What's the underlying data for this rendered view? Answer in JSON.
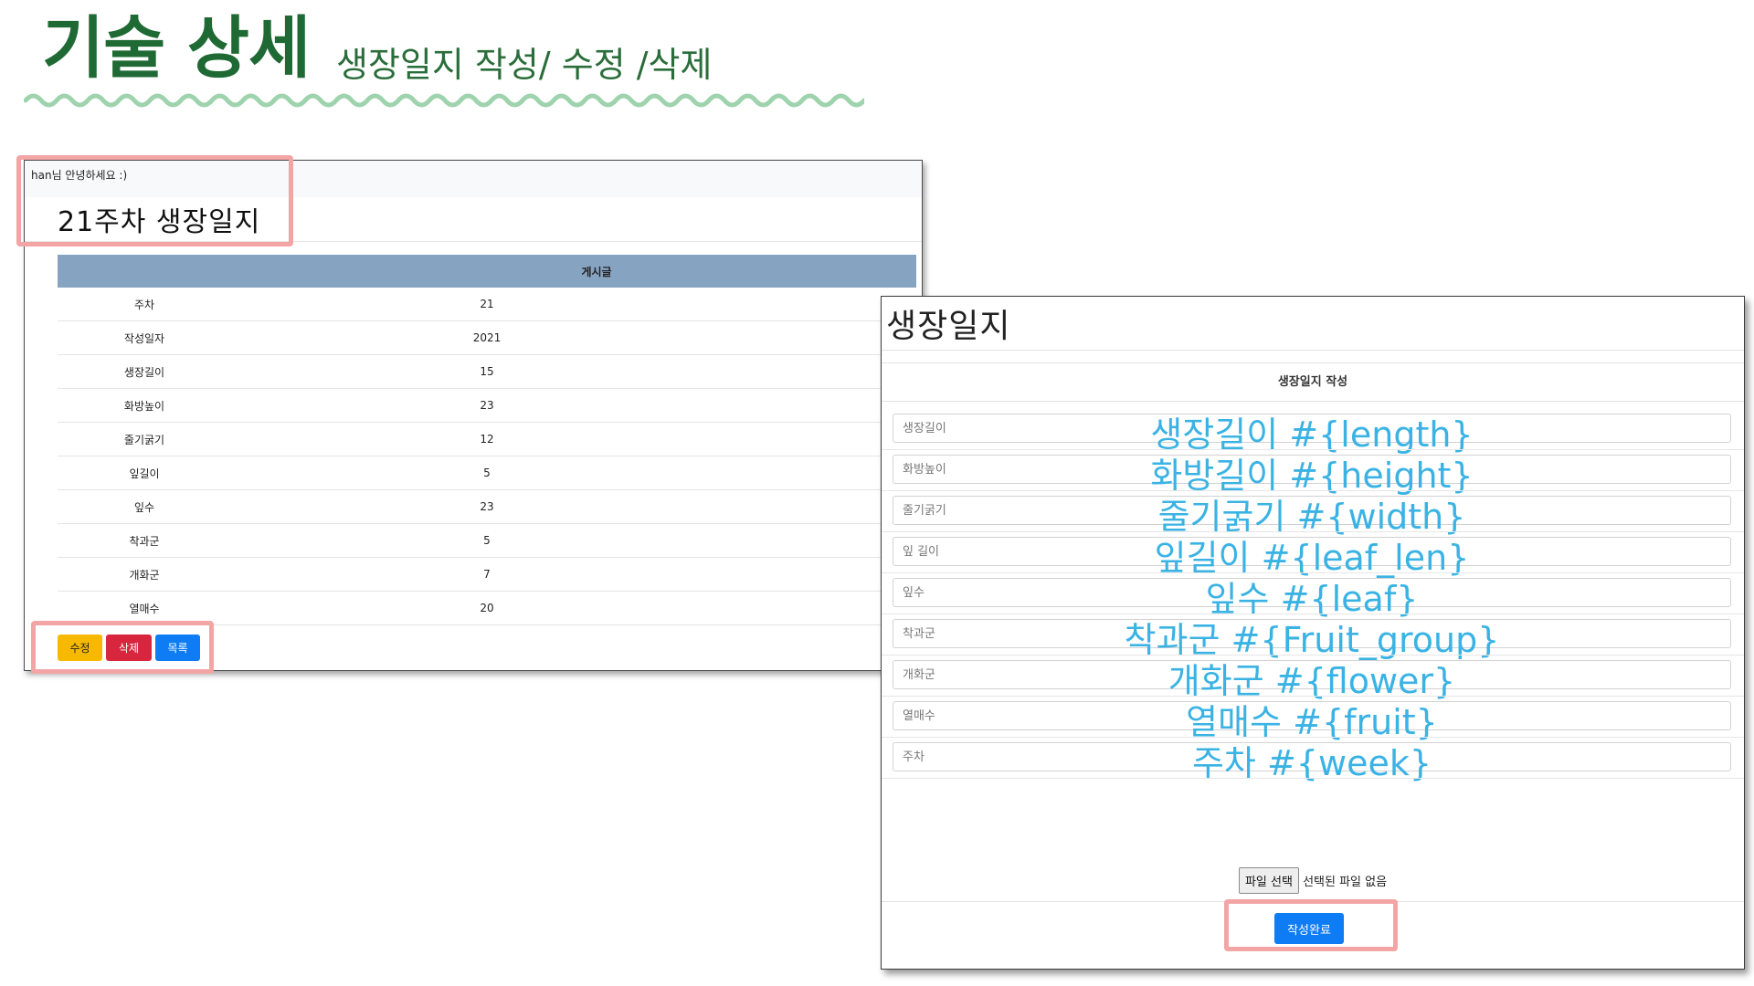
{
  "slide": {
    "title": "기술 상세",
    "subtitle": "생장일지 작성/ 수정 /삭제",
    "accent_color": "#1f6a34",
    "wave_color": "#9ed3ad"
  },
  "detail_view": {
    "greeting": "han님 안녕하세요 :)",
    "page_title": "21주차 생장일지",
    "table_header": "게시글",
    "rows": [
      {
        "label": "주차",
        "value": "21"
      },
      {
        "label": "작성일자",
        "value": "2021"
      },
      {
        "label": "생장길이",
        "value": "15"
      },
      {
        "label": "화방높이",
        "value": "23"
      },
      {
        "label": "줄기굵기",
        "value": "12"
      },
      {
        "label": "잎길이",
        "value": "5"
      },
      {
        "label": "잎수",
        "value": "23"
      },
      {
        "label": "착과군",
        "value": "5"
      },
      {
        "label": "개화군",
        "value": "7"
      },
      {
        "label": "열매수",
        "value": "20"
      }
    ],
    "buttons": {
      "edit": "수정",
      "delete": "삭제",
      "list": "목록"
    },
    "header_color": "#87a3c2"
  },
  "write_form": {
    "heading": "생장일지",
    "form_title": "생장일지 작성",
    "fields": [
      {
        "placeholder": "생장길이",
        "overlay": "생장길이 #{length}"
      },
      {
        "placeholder": "화방높이",
        "overlay": "화방길이 #{height}"
      },
      {
        "placeholder": "줄기굵기",
        "overlay": "줄기굵기 #{width}"
      },
      {
        "placeholder": "잎 길이",
        "overlay": "잎길이 #{leaf_len}"
      },
      {
        "placeholder": "잎수",
        "overlay": "잎수 #{leaf}"
      },
      {
        "placeholder": "착과군",
        "overlay": "착과군 #{Fruit_group}"
      },
      {
        "placeholder": "개화군",
        "overlay": "개화군 #{flower}"
      },
      {
        "placeholder": "열매수",
        "overlay": "열매수 #{fruit}"
      },
      {
        "placeholder": "주차",
        "overlay": "주차 #{week}"
      }
    ],
    "file_button": "파일 선택",
    "file_status": "선택된 파일 없음",
    "submit": "작성완료",
    "overlay_color": "#3ab3e4",
    "button_color": "#0d7cf5"
  },
  "highlight_color": "#f3a4a4"
}
